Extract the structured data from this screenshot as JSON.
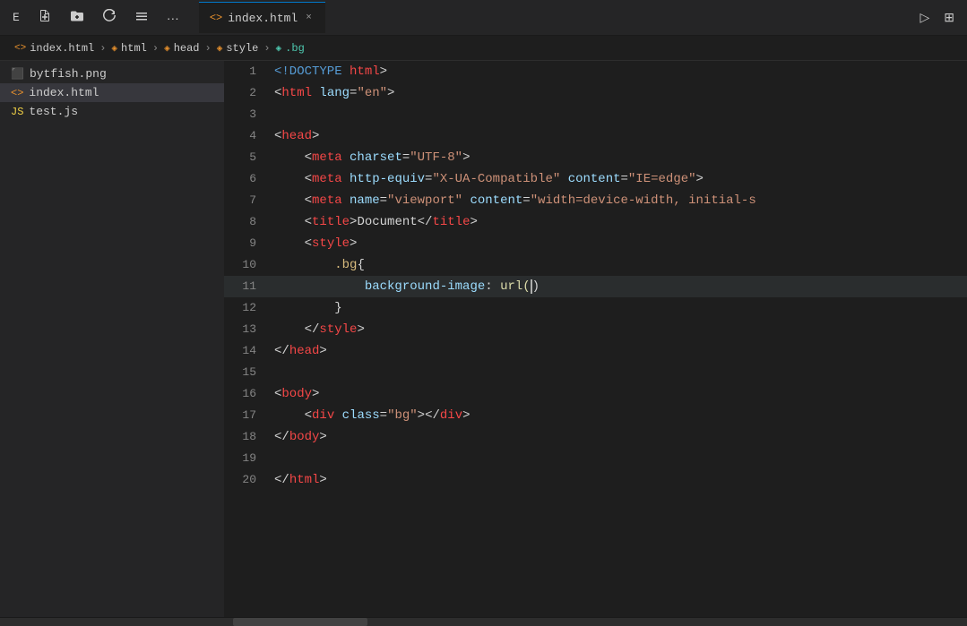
{
  "titlebar": {
    "icon_label": "E",
    "buttons": [
      "new-file",
      "new-folder",
      "refresh",
      "collapse"
    ],
    "dots_label": "···",
    "tab_icon": "<>",
    "tab_filename": "index.html",
    "tab_close": "×",
    "action_run": "▷",
    "action_layout": "⊞"
  },
  "breadcrumb": {
    "items": [
      {
        "icon": "<>",
        "label": "index.html",
        "type": "file"
      },
      {
        "icon": "◈",
        "label": "html",
        "type": "tag"
      },
      {
        "icon": "◈",
        "label": "head",
        "type": "tag"
      },
      {
        "icon": "◈",
        "label": "style",
        "type": "tag"
      },
      {
        "icon": "◈",
        "label": ".bg",
        "type": "class"
      }
    ]
  },
  "sidebar": {
    "files": [
      {
        "name": "bytfish.png",
        "icon": "png",
        "active": false
      },
      {
        "name": "index.html",
        "icon": "html",
        "active": true
      },
      {
        "name": "test.js",
        "icon": "js",
        "active": false
      }
    ]
  },
  "editor": {
    "lines": [
      {
        "num": 1,
        "tokens": [
          {
            "t": "kw",
            "v": "<!DOCTYPE"
          },
          {
            "t": "punc",
            "v": " "
          },
          {
            "t": "tag",
            "v": "html"
          },
          {
            "t": "punc",
            "v": ">"
          }
        ]
      },
      {
        "num": 2,
        "tokens": [
          {
            "t": "punc",
            "v": "<"
          },
          {
            "t": "tag",
            "v": "html"
          },
          {
            "t": "punc",
            "v": " "
          },
          {
            "t": "attr",
            "v": "lang"
          },
          {
            "t": "punc",
            "v": "="
          },
          {
            "t": "str",
            "v": "\"en\""
          },
          {
            "t": "punc",
            "v": ">"
          }
        ]
      },
      {
        "num": 3,
        "tokens": []
      },
      {
        "num": 4,
        "tokens": [
          {
            "t": "punc",
            "v": "<"
          },
          {
            "t": "tag",
            "v": "head"
          },
          {
            "t": "punc",
            "v": ">"
          }
        ]
      },
      {
        "num": 5,
        "tokens": [
          {
            "t": "punc",
            "v": "    <"
          },
          {
            "t": "tag",
            "v": "meta"
          },
          {
            "t": "punc",
            "v": " "
          },
          {
            "t": "attr",
            "v": "charset"
          },
          {
            "t": "punc",
            "v": "="
          },
          {
            "t": "str",
            "v": "\"UTF-8\""
          },
          {
            "t": "punc",
            "v": ">"
          }
        ]
      },
      {
        "num": 6,
        "tokens": [
          {
            "t": "punc",
            "v": "    <"
          },
          {
            "t": "tag",
            "v": "meta"
          },
          {
            "t": "punc",
            "v": " "
          },
          {
            "t": "attr",
            "v": "http-equiv"
          },
          {
            "t": "punc",
            "v": "="
          },
          {
            "t": "str",
            "v": "\"X-UA-Compatible\""
          },
          {
            "t": "punc",
            "v": " "
          },
          {
            "t": "attr",
            "v": "content"
          },
          {
            "t": "punc",
            "v": "="
          },
          {
            "t": "str",
            "v": "\"IE=edge\""
          },
          {
            "t": "punc",
            "v": ">"
          }
        ]
      },
      {
        "num": 7,
        "tokens": [
          {
            "t": "punc",
            "v": "    <"
          },
          {
            "t": "tag",
            "v": "meta"
          },
          {
            "t": "punc",
            "v": " "
          },
          {
            "t": "attr",
            "v": "name"
          },
          {
            "t": "punc",
            "v": "="
          },
          {
            "t": "str",
            "v": "\"viewport\""
          },
          {
            "t": "punc",
            "v": " "
          },
          {
            "t": "attr",
            "v": "content"
          },
          {
            "t": "punc",
            "v": "="
          },
          {
            "t": "str",
            "v": "\"width=device-width, initial-s"
          }
        ]
      },
      {
        "num": 8,
        "tokens": [
          {
            "t": "punc",
            "v": "    <"
          },
          {
            "t": "tag",
            "v": "title"
          },
          {
            "t": "punc",
            "v": ">"
          },
          {
            "t": "plain",
            "v": "Document"
          },
          {
            "t": "punc",
            "v": "</"
          },
          {
            "t": "tag",
            "v": "title"
          },
          {
            "t": "punc",
            "v": ">"
          }
        ]
      },
      {
        "num": 9,
        "tokens": [
          {
            "t": "punc",
            "v": "    <"
          },
          {
            "t": "tag",
            "v": "style"
          },
          {
            "t": "punc",
            "v": ">"
          }
        ]
      },
      {
        "num": 10,
        "tokens": [
          {
            "t": "punc",
            "v": "        "
          },
          {
            "t": "css-sel",
            "v": ".bg"
          },
          {
            "t": "punc",
            "v": "{"
          }
        ]
      },
      {
        "num": 11,
        "tokens": [
          {
            "t": "punc",
            "v": "            "
          },
          {
            "t": "css-prop",
            "v": "background-image"
          },
          {
            "t": "punc",
            "v": ": "
          },
          {
            "t": "css-fn",
            "v": "url("
          },
          {
            "t": "cursor",
            "v": ""
          },
          {
            "t": "punc",
            "v": ")"
          }
        ],
        "active": true
      },
      {
        "num": 12,
        "tokens": [
          {
            "t": "punc",
            "v": "        }"
          }
        ]
      },
      {
        "num": 13,
        "tokens": [
          {
            "t": "punc",
            "v": "    </"
          },
          {
            "t": "tag",
            "v": "style"
          },
          {
            "t": "punc",
            "v": ">"
          }
        ]
      },
      {
        "num": 14,
        "tokens": [
          {
            "t": "punc",
            "v": "</"
          },
          {
            "t": "tag",
            "v": "head"
          },
          {
            "t": "punc",
            "v": ">"
          }
        ]
      },
      {
        "num": 15,
        "tokens": []
      },
      {
        "num": 16,
        "tokens": [
          {
            "t": "punc",
            "v": "<"
          },
          {
            "t": "tag",
            "v": "body"
          },
          {
            "t": "punc",
            "v": ">"
          }
        ]
      },
      {
        "num": 17,
        "tokens": [
          {
            "t": "punc",
            "v": "    <"
          },
          {
            "t": "tag",
            "v": "div"
          },
          {
            "t": "punc",
            "v": " "
          },
          {
            "t": "attr",
            "v": "class"
          },
          {
            "t": "punc",
            "v": "="
          },
          {
            "t": "str",
            "v": "\"bg\""
          },
          {
            "t": "punc",
            "v": "></"
          },
          {
            "t": "tag",
            "v": "div"
          },
          {
            "t": "punc",
            "v": ">"
          }
        ]
      },
      {
        "num": 18,
        "tokens": [
          {
            "t": "punc",
            "v": "</"
          },
          {
            "t": "tag",
            "v": "body"
          },
          {
            "t": "punc",
            "v": ">"
          }
        ]
      },
      {
        "num": 19,
        "tokens": []
      },
      {
        "num": 20,
        "tokens": [
          {
            "t": "punc",
            "v": "</"
          },
          {
            "t": "tag",
            "v": "html"
          },
          {
            "t": "punc",
            "v": ">"
          }
        ]
      }
    ]
  }
}
